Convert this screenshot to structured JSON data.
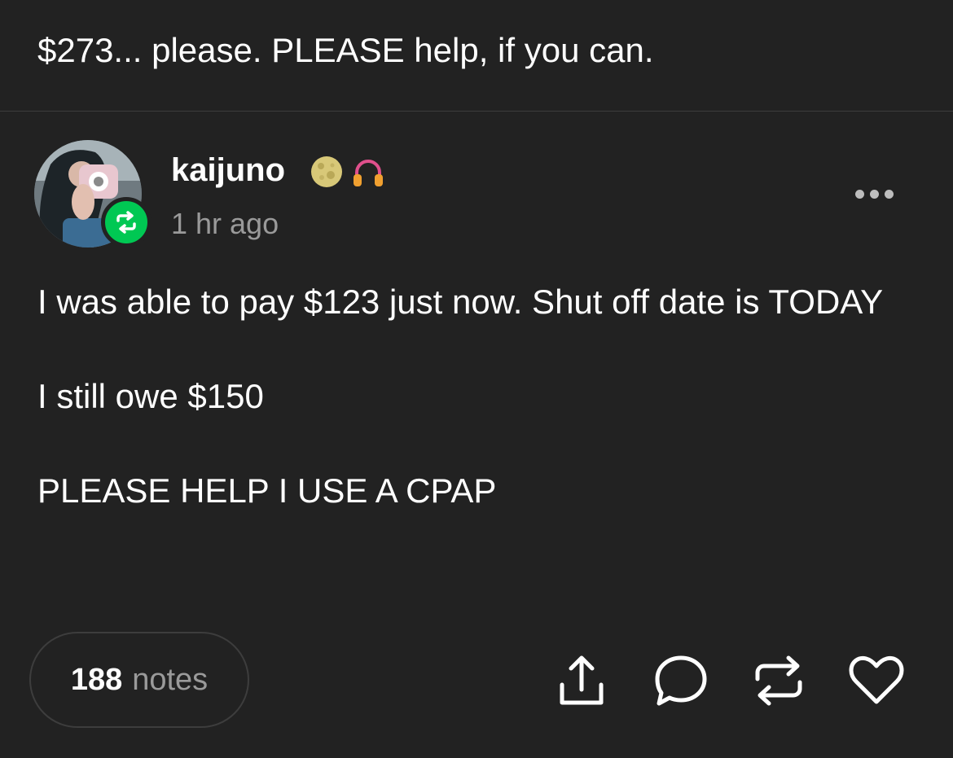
{
  "previous_post": {
    "text": "$273... please. PLEASE help, if you can."
  },
  "post": {
    "username": "kaijuno",
    "badges": [
      "moon-badge-icon",
      "headphones-badge-icon"
    ],
    "timestamp": "1 hr ago",
    "paragraphs": [
      "I was able to pay $123 just now. Shut off date is TODAY",
      "I still owe $150",
      "PLEASE HELP I USE A CPAP"
    ]
  },
  "footer": {
    "notes_count": "188",
    "notes_label": "notes",
    "actions": [
      "share-icon",
      "reply-icon",
      "reblog-icon",
      "like-icon"
    ]
  },
  "colors": {
    "background": "#222222",
    "text": "#ffffff",
    "muted": "#9a9a9a",
    "reblog_green": "#00c853"
  }
}
